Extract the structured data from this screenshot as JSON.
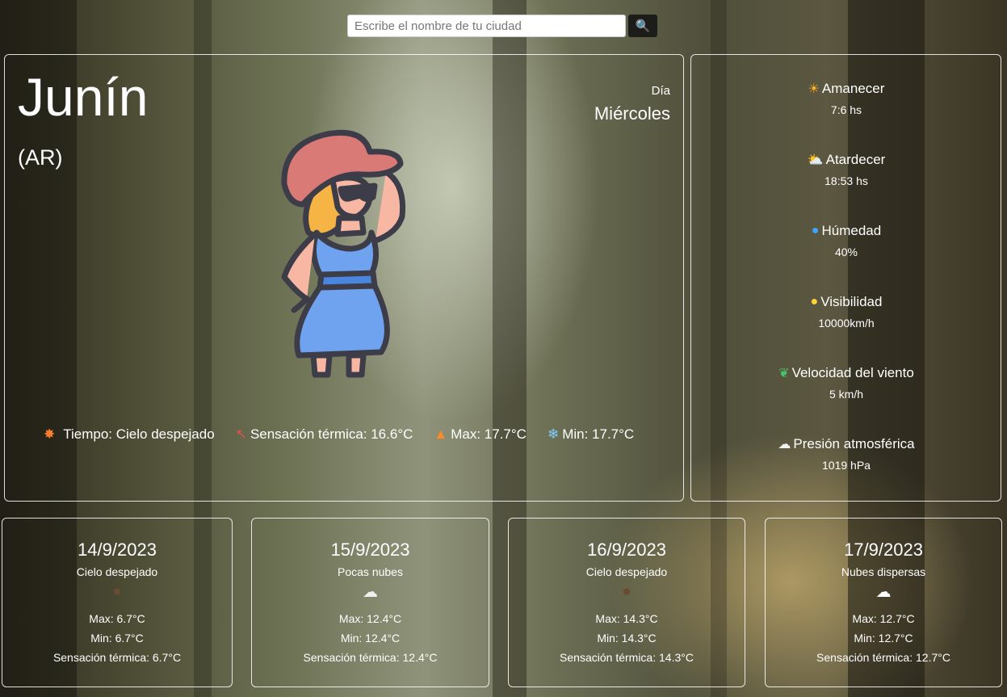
{
  "search": {
    "placeholder": "Escribe el nombre de tu ciudad",
    "button_icon": "search-icon"
  },
  "current": {
    "city": "Junín",
    "country": "(AR)",
    "day_label": "Día",
    "day": "Miércoles",
    "illustration": "woman-in-sun-hat",
    "stats": [
      {
        "icon": "sun-icon",
        "label": "Tiempo: Cielo despejado"
      },
      {
        "icon": "thermometer-icon",
        "label": "Sensación térmica: 16.6°C"
      },
      {
        "icon": "flame-icon",
        "label": "Max: 17.7°C"
      },
      {
        "icon": "snowflake-icon",
        "label": "Min: 17.7°C"
      }
    ]
  },
  "details": [
    {
      "icon": "sunrise-icon",
      "title": "Amanecer",
      "value": "7:6 hs"
    },
    {
      "icon": "sunset-icon",
      "title": "Atardecer",
      "value": "18:53 hs"
    },
    {
      "icon": "droplet-icon",
      "title": "Húmedad",
      "value": "40%"
    },
    {
      "icon": "lightbulb-icon",
      "title": "Visibilidad",
      "value": "10000km/h"
    },
    {
      "icon": "leaf-icon",
      "title": "Velocidad del viento",
      "value": "5 km/h"
    },
    {
      "icon": "cloud-icon",
      "title": "Presión atmosférica",
      "value": "1019 hPa"
    }
  ],
  "forecast": [
    {
      "date": "14/9/2023",
      "desc": "Cielo despejado",
      "icon": "clear-sky-icon",
      "max": "Max: 6.7°C",
      "min": "Min: 6.7°C",
      "feels": "Sensación térmica: 6.7°C"
    },
    {
      "date": "15/9/2023",
      "desc": "Pocas nubes",
      "icon": "few-clouds-icon",
      "max": "Max: 12.4°C",
      "min": "Min: 12.4°C",
      "feels": "Sensación térmica: 12.4°C"
    },
    {
      "date": "16/9/2023",
      "desc": "Cielo despejado",
      "icon": "clear-sky-icon",
      "max": "Max: 14.3°C",
      "min": "Min: 14.3°C",
      "feels": "Sensación térmica: 14.3°C"
    },
    {
      "date": "17/9/2023",
      "desc": "Nubes dispersas",
      "icon": "scattered-clouds-icon",
      "max": "Max: 12.7°C",
      "min": "Min: 12.7°C",
      "feels": "Sensación térmica: 12.7°C"
    }
  ],
  "colors": {
    "card_border": "#ffffff",
    "search_button": "#1c1c19",
    "dress": "#6fa3f0",
    "hat": "#d97a76",
    "hair": "#f5b443"
  }
}
